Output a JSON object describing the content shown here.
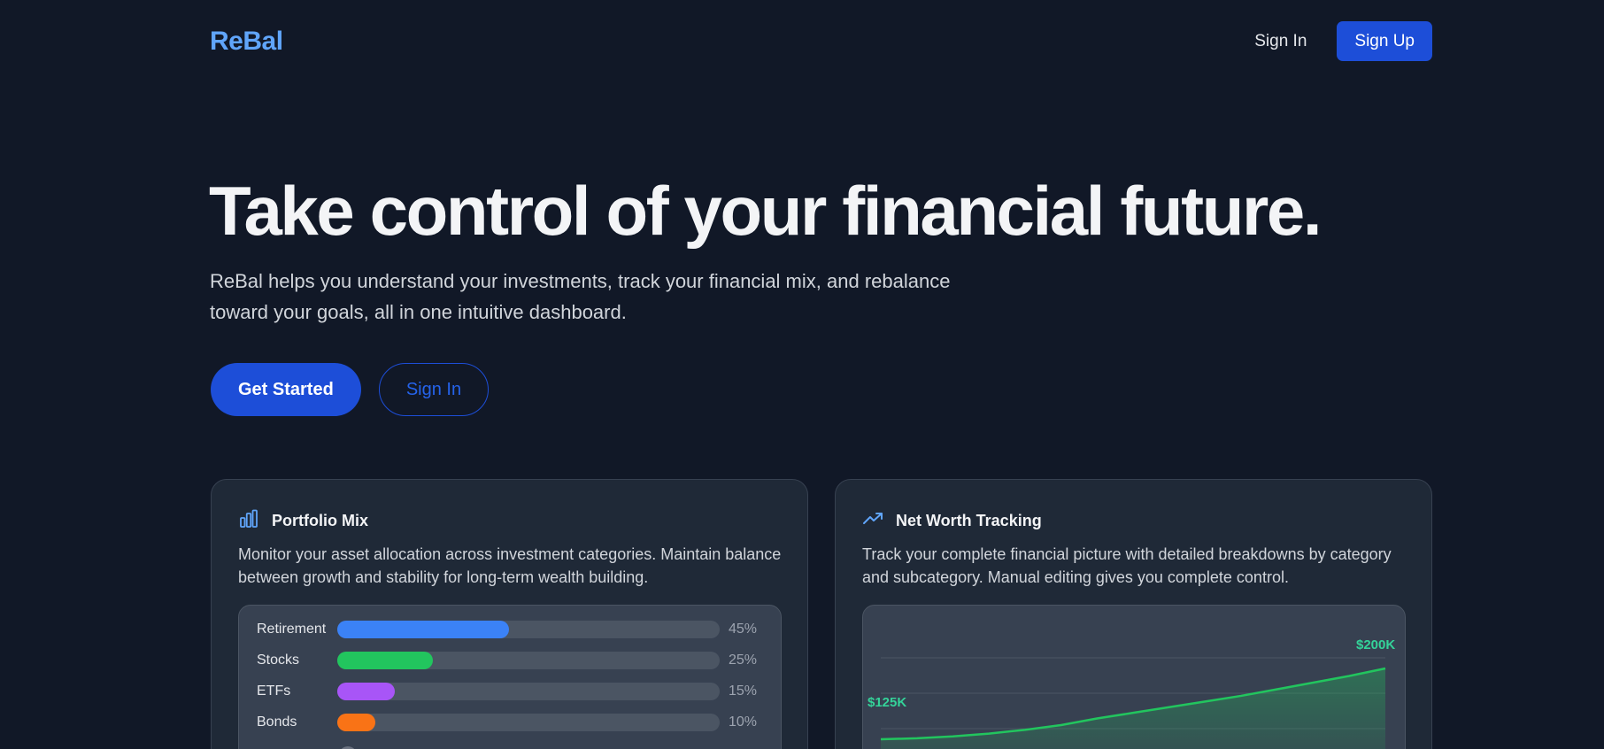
{
  "nav": {
    "logo": "ReBal",
    "signin": "Sign In",
    "signup": "Sign Up"
  },
  "hero": {
    "title": "Take control of your financial future.",
    "subtitle": "ReBal helps you understand your investments, track your financial mix, and rebalance toward your goals, all in one intuitive dashboard.",
    "cta_primary": "Get Started",
    "cta_secondary": "Sign In"
  },
  "cards": {
    "portfolio": {
      "title": "Portfolio Mix",
      "icon": "bar-chart-icon",
      "description": "Monitor your asset allocation across investment categories. Maintain balance between growth and stability for long-term wealth building.",
      "items": [
        {
          "label": "Retirement",
          "percent": 45,
          "pct_text": "45%",
          "color": "#3b82f6"
        },
        {
          "label": "Stocks",
          "percent": 25,
          "pct_text": "25%",
          "color": "#22c55e"
        },
        {
          "label": "ETFs",
          "percent": 15,
          "pct_text": "15%",
          "color": "#a855f7"
        },
        {
          "label": "Bonds",
          "percent": 10,
          "pct_text": "10%",
          "color": "#f97316"
        }
      ]
    },
    "networth": {
      "title": "Net Worth Tracking",
      "icon": "trending-up-icon",
      "description": "Track your complete financial picture with detailed breakdowns by category and subcategory. Manual editing gives you complete control.",
      "start_label": "$125K",
      "end_label": "$200K",
      "line_color": "#22c55e"
    }
  },
  "chart_data": {
    "type": "area",
    "title": "",
    "xlabel": "",
    "ylabel": "",
    "series": [
      {
        "values": [
          125,
          126,
          128,
          131,
          135,
          140,
          147,
          153,
          159,
          165,
          171,
          178,
          185,
          192,
          200
        ]
      }
    ],
    "annotations": [
      "$125K",
      "$200K"
    ],
    "grid": true
  },
  "colors": {
    "accent": "#1d4ed8",
    "logo": "#60a5fa",
    "background": "#111827",
    "card": "#1f2937"
  }
}
